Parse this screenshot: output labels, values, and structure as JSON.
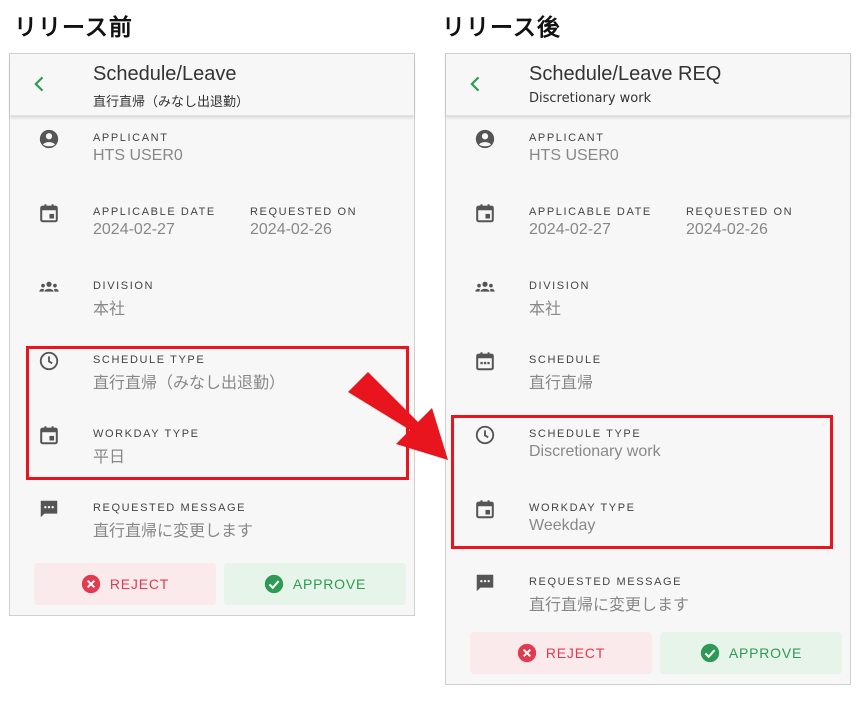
{
  "captions": {
    "before": "リリース前",
    "after": "リリース後"
  },
  "colors": {
    "accent": "#2e9a55",
    "reject": "#e23a4f",
    "highlight": "#e8141e"
  },
  "before": {
    "header": {
      "back_icon": "chevron-left-icon",
      "title": "Schedule/Leave",
      "subtitle": "直行直帰（みなし出退勤）"
    },
    "fields": {
      "applicant": {
        "icon": "account-circle-icon",
        "label": "APPLICANT",
        "value": "HTS USER0"
      },
      "applicable_date": {
        "icon": "calendar-icon",
        "label": "APPLICABLE DATE",
        "value": "2024-02-27"
      },
      "requested_on": {
        "label": "REQUESTED ON",
        "value": "2024-02-26"
      },
      "division": {
        "icon": "group-icon",
        "label": "DIVISION",
        "value": "本社"
      },
      "schedule_type": {
        "icon": "clock-icon",
        "label": "SCHEDULE TYPE",
        "value": "直行直帰（みなし出退勤）"
      },
      "workday_type": {
        "icon": "calendar-icon",
        "label": "WORKDAY TYPE",
        "value": "平日"
      },
      "requested_message": {
        "icon": "message-icon",
        "label": "REQUESTED MESSAGE",
        "value": "直行直帰に変更します"
      }
    },
    "buttons": {
      "reject": "REJECT",
      "approve": "APPROVE"
    }
  },
  "after": {
    "header": {
      "back_icon": "chevron-left-icon",
      "title": "Schedule/Leave REQ",
      "subtitle": "Discretionary work"
    },
    "fields": {
      "applicant": {
        "icon": "account-circle-icon",
        "label": "APPLICANT",
        "value": "HTS USER0"
      },
      "applicable_date": {
        "icon": "calendar-icon",
        "label": "APPLICABLE DATE",
        "value": "2024-02-27"
      },
      "requested_on": {
        "label": "REQUESTED ON",
        "value": "2024-02-26"
      },
      "division": {
        "icon": "group-icon",
        "label": "DIVISION",
        "value": "本社"
      },
      "schedule": {
        "icon": "calendar-dots-icon",
        "label": "SCHEDULE",
        "value": "直行直帰"
      },
      "schedule_type": {
        "icon": "clock-icon",
        "label": "SCHEDULE TYPE",
        "value": "Discretionary work"
      },
      "workday_type": {
        "icon": "calendar-icon",
        "label": "WORKDAY TYPE",
        "value": "Weekday"
      },
      "requested_message": {
        "icon": "message-icon",
        "label": "REQUESTED MESSAGE",
        "value": "直行直帰に変更します"
      }
    },
    "buttons": {
      "reject": "REJECT",
      "approve": "APPROVE"
    }
  }
}
